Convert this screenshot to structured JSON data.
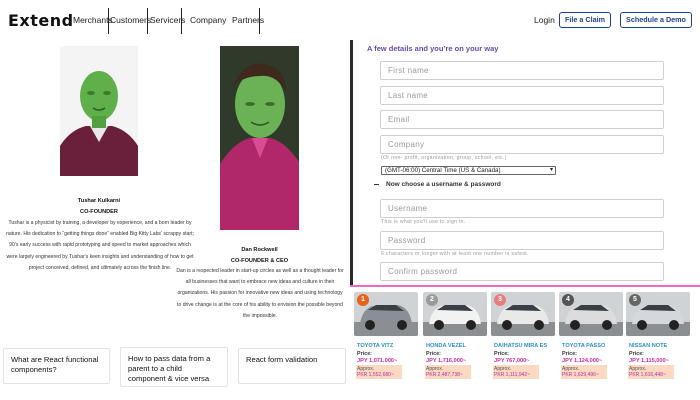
{
  "nav": {
    "logo": "Extend",
    "links": [
      "Merchants",
      "Customers",
      "Servicers",
      "Company",
      "Partners"
    ],
    "login": "Login",
    "file_claim": "File a Claim",
    "schedule_demo": "Schedule a Demo"
  },
  "people": [
    {
      "name": "Tushar Kulkarni",
      "role": "CO-FOUNDER",
      "bio": "Tushar is a physicist by training, a developer by experience, and a born leader by nature. His dedication to “getting things done” enabled Big Kitty Labs' scrappy start; 90’s early success with rapid prototyping and speed to market approaches which were largely engineered by Tushar's keen insights and understanding of how to get project conceived, defined, and ultimately across the finish line."
    },
    {
      "name": "Dan Rockwell",
      "role": "CO-FOUNDER & CEO",
      "bio": "Dan is a respected leader in start-up circles as well as a thought leader for all businesses that want to embrace new ideas and culture in their organizations. His passion for innovative new ideas and using technology to drive change is at the core of his ability to envision the possible beyond the impossible."
    }
  ],
  "cards": [
    "What are React functional components?",
    "How to pass data from a parent to a child component & vice versa",
    "React form validation"
  ],
  "form": {
    "title": "A few details and you’re on your way",
    "fields": {
      "first_name": "First name",
      "last_name": "Last name",
      "email": "Email",
      "company": "Company",
      "username": "Username",
      "password": "Password",
      "confirm_password": "Confirm password"
    },
    "company_hint": "(Or non- profit, organization, group, school, etc.)",
    "timezone": "(GMT-06:00) Central Time (US & Canada)",
    "section_title": "Now choose a username & password",
    "username_hint": "This is what you'll use to sign in.",
    "password_hint": "6 characters or longer with at least one number is safest."
  },
  "cars": [
    {
      "rank": "1",
      "name": "TOYOTA VITZ",
      "price": "JPY 1,071,000~",
      "approx": "Approx.",
      "pkr": "PKR 1,552,680~",
      "badge_color": "#e8621a",
      "body_color": "#8a8f96"
    },
    {
      "rank": "2",
      "name": "HONDA VEZEL",
      "price": "JPY 1,716,000~",
      "approx": "Approx.",
      "pkr": "PKR 2,487,738~",
      "badge_color": "#9a9a9a",
      "body_color": "#f2f2f2"
    },
    {
      "rank": "3",
      "name": "DAIHATSU MIRA ES",
      "price": "JPY 767,000~",
      "approx": "Approx.",
      "pkr": "PKR 1,111,942~",
      "badge_color": "#e87f7f",
      "body_color": "#e9e9ea"
    },
    {
      "rank": "4",
      "name": "TOYOTA PASSO",
      "price": "JPY 1,124,000~",
      "approx": "Approx.",
      "pkr": "PKR 1,629,496~",
      "badge_color": "#555555",
      "body_color": "#dcdcdc"
    },
    {
      "rank": "5",
      "name": "NISSAN NOTE",
      "price": "JPY 1,115,000~",
      "approx": "Approx.",
      "pkr": "PKR 1,616,448~",
      "badge_color": "#666666",
      "body_color": "#d5d8da"
    }
  ],
  "price_label": "Price:"
}
